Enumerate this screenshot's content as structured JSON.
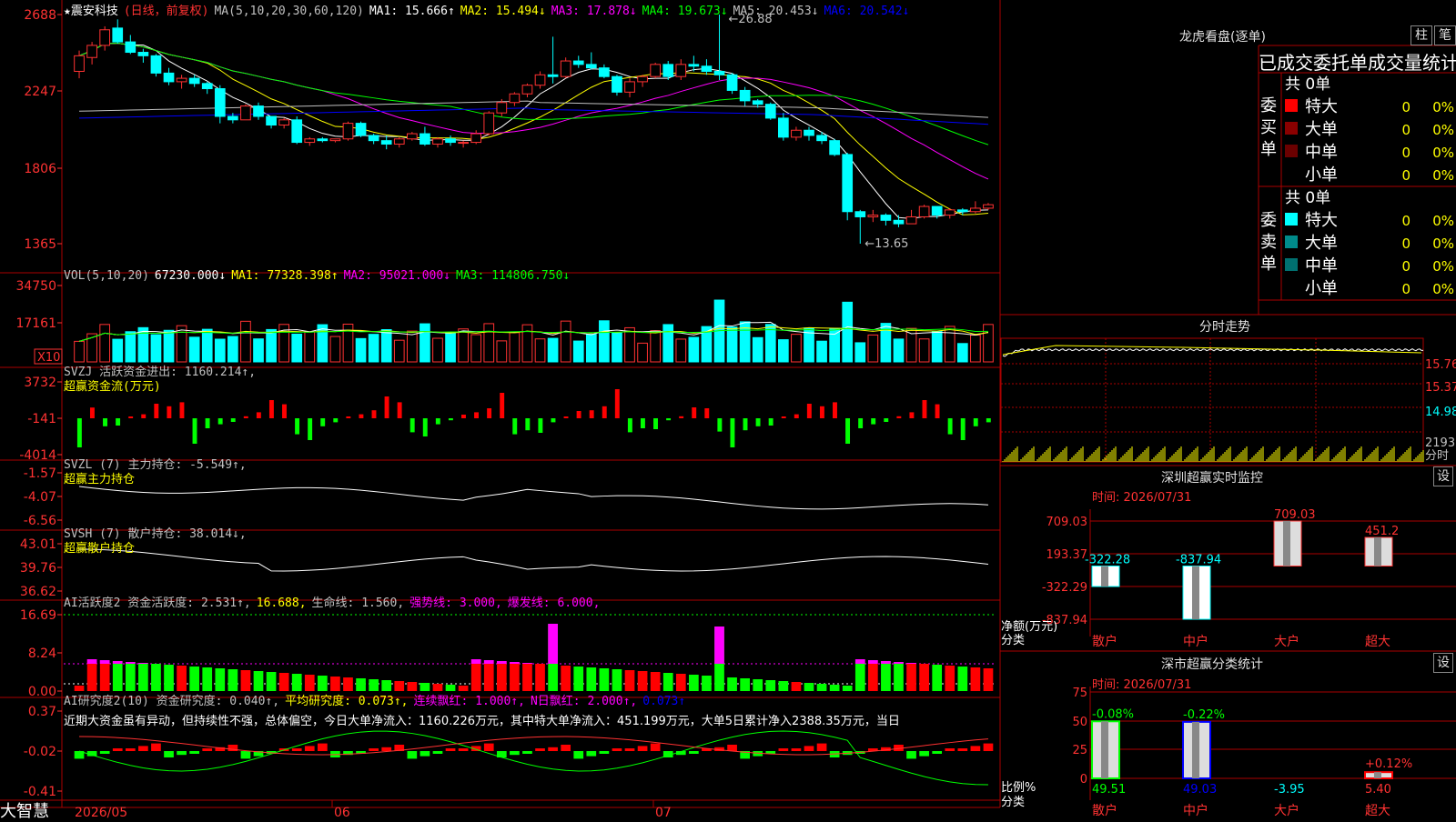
{
  "stock": {
    "title": "★震安科技",
    "mode": "(日线，前复权)"
  },
  "ma_header": [
    {
      "label": "MA(5,10,20,30,60,120)",
      "color": "#c0c0c0"
    },
    {
      "label": "MA1: 15.666↑",
      "color": "#ffffff"
    },
    {
      "label": "MA2: 15.494↓",
      "color": "#ffff00"
    },
    {
      "label": "MA3: 17.878↓",
      "color": "#ff00ff"
    },
    {
      "label": "MA4: 19.673↓",
      "color": "#00ff00"
    },
    {
      "label": "MA5: 20.453↓",
      "color": "#c0c0c0"
    },
    {
      "label": "MA6: 20.542↓",
      "color": "#0000ff"
    }
  ],
  "vol_header": [
    {
      "label": "VOL(5,10,20)",
      "color": "#c0c0c0"
    },
    {
      "label": "67230.000↓",
      "color": "#ffffff"
    },
    {
      "label": "MA1: 77328.398↑",
      "color": "#ffff00"
    },
    {
      "label": "MA2: 95021.000↓",
      "color": "#ff00ff"
    },
    {
      "label": "MA3: 114806.750↓",
      "color": "#00ff00"
    }
  ],
  "svzj_header": [
    {
      "label": "SVZJ  活跃资金进出: 1160.214↑,",
      "color": "#c0c0c0"
    }
  ],
  "svzj_sub": "超赢资金流(万元)",
  "svzl_header": [
    {
      "label": "SVZL (7) 主力持仓: -5.549↑,",
      "color": "#c0c0c0"
    }
  ],
  "svzl_sub": "超赢主力持仓",
  "svsh_header": [
    {
      "label": "SVSH (7) 散户持仓: 38.014↓,",
      "color": "#c0c0c0"
    }
  ],
  "svsh_sub": "超赢散户持仓",
  "ai1_header": [
    {
      "label": "AI活跃度2 资金活跃度: 2.531↑,",
      "color": "#c0c0c0"
    },
    {
      "label": "16.688,",
      "color": "#ffff00"
    },
    {
      "label": "生命线: 1.560,",
      "color": "#c0c0c0"
    },
    {
      "label": "强势线: 3.000,",
      "color": "#ff00ff"
    },
    {
      "label": "爆发线: 6.000,",
      "color": "#ff00ff"
    }
  ],
  "ai2_header": [
    {
      "label": "AI研究度2(10) 资金研究度: 0.040↑,",
      "color": "#c0c0c0"
    },
    {
      "label": "平均研究度: 0.073↑,",
      "color": "#ffff00"
    },
    {
      "label": "连续飘红: 1.000↑,",
      "color": "#ff00ff"
    },
    {
      "label": "N日飘红: 2.000↑,",
      "color": "#ff00ff"
    },
    {
      "label": "0.073↑",
      "color": "#0000ff"
    }
  ],
  "ai2_text": "近期大资金虽有异动，但持续性不强，总体偏空，今日大单净流入：1160.226万元，其中特大单净流入：451.199万元，大单5日累计净入2388.35万元，当日",
  "price_ticks": [
    "2688",
    "2247",
    "1806",
    "1365"
  ],
  "vol_ticks": [
    "34750",
    "17161"
  ],
  "vol_unit": "X10",
  "svzj_ticks": [
    "3732",
    "-141",
    "-4014"
  ],
  "svzl_ticks": [
    "-1.57",
    "-4.07",
    "-6.56"
  ],
  "svsh_ticks": [
    "43.01",
    "39.76",
    "36.62"
  ],
  "ai1_ticks": [
    "16.69",
    "8.24",
    "0.00"
  ],
  "ai2_ticks": [
    "0.37",
    "-0.02",
    "-0.41"
  ],
  "price_annot": {
    "high": "←26.88",
    "low": "←13.65"
  },
  "date_labels": [
    "2026/05",
    "06",
    "07"
  ],
  "brand": "大智慧",
  "dragon": {
    "title": "龙虎看盘(逐单)",
    "btn1": "柱",
    "btn2": "笔",
    "stat_title": "已成交委托单成交量统计",
    "buy_label": "委买单",
    "sell_label": "委卖单",
    "buy_count": "共 0单",
    "sell_count": "共 0单",
    "buy_rows": [
      {
        "name": "特大",
        "v": "0",
        "p": "0%",
        "c": "#ff0000"
      },
      {
        "name": "大单",
        "v": "0",
        "p": "0%",
        "c": "#8b0000"
      },
      {
        "name": "中单",
        "v": "0",
        "p": "0%",
        "c": "#6b0000"
      },
      {
        "name": "小单",
        "v": "0",
        "p": "0%",
        "c": ""
      }
    ],
    "sell_rows": [
      {
        "name": "特大",
        "v": "0",
        "p": "0%",
        "c": "#00ffff"
      },
      {
        "name": "大单",
        "v": "0",
        "p": "0%",
        "c": "#008b8b"
      },
      {
        "name": "中单",
        "v": "0",
        "p": "0%",
        "c": "#007070"
      },
      {
        "name": "小单",
        "v": "0",
        "p": "0%",
        "c": ""
      }
    ]
  },
  "intraday": {
    "title": "分时走势",
    "ticks": [
      "15.76",
      "15.37",
      "14.98",
      "2193"
    ],
    "vol_label": "分时"
  },
  "sz_monitor": {
    "title": "深圳超赢实时监控",
    "btn": "设",
    "time": "时间: 2026/07/31",
    "ticks": [
      "709.03",
      "193.37",
      "-322.29",
      "-837.94"
    ],
    "ylabel": "净额(万元)",
    "xlabel": "分类",
    "cats": [
      "散户",
      "中户",
      "大户",
      "超大"
    ]
  },
  "sz_class": {
    "title": "深市超赢分类统计",
    "btn": "设",
    "time": "时间: 2026/07/31",
    "ticks": [
      "75",
      "50",
      "25",
      "0"
    ],
    "ylabel": "比例%",
    "xlabel": "分类",
    "cats": [
      "散户",
      "中户",
      "大户",
      "超大"
    ]
  },
  "chart_data": [
    {
      "type": "bar",
      "name": "深圳超赢实时监控",
      "categories": [
        "散户",
        "中户",
        "大户",
        "超大"
      ],
      "values": [
        -322.28,
        -837.94,
        709.03,
        451.2
      ],
      "ylim": [
        -837.94,
        709.03
      ]
    },
    {
      "type": "bar",
      "name": "深市超赢分类统计",
      "categories": [
        "散户",
        "中户",
        "大户",
        "超大"
      ],
      "series": [
        {
          "values": [
            49.51,
            49.03,
            -3.95,
            5.4
          ]
        },
        {
          "values": [
            -0.08,
            -0.22,
            0,
            0.12
          ]
        }
      ],
      "ylim": [
        0,
        75
      ]
    },
    {
      "type": "line",
      "name": "candles",
      "ylim": [
        13.65,
        26.88
      ],
      "ohlc": [
        [
          23.6,
          24.8,
          23.2,
          24.5
        ],
        [
          24.4,
          25.3,
          24.0,
          25.1
        ],
        [
          25.1,
          26.2,
          24.8,
          26.0
        ],
        [
          26.1,
          26.6,
          25.2,
          25.3
        ],
        [
          25.3,
          25.7,
          24.6,
          24.7
        ],
        [
          24.7,
          24.9,
          24.1,
          24.5
        ],
        [
          24.5,
          24.6,
          23.3,
          23.5
        ],
        [
          23.5,
          23.8,
          22.8,
          23.0
        ],
        [
          23.0,
          23.4,
          22.6,
          23.2
        ],
        [
          23.2,
          23.4,
          22.7,
          22.9
        ],
        [
          22.9,
          23.0,
          22.3,
          22.6
        ],
        [
          22.6,
          22.8,
          20.6,
          21.0
        ],
        [
          21.0,
          21.2,
          20.6,
          20.8
        ],
        [
          20.8,
          21.7,
          20.8,
          21.6
        ],
        [
          21.6,
          21.8,
          20.8,
          21.0
        ],
        [
          21.0,
          21.0,
          20.3,
          20.5
        ],
        [
          20.5,
          20.9,
          20.3,
          20.8
        ],
        [
          20.8,
          21.0,
          19.4,
          19.5
        ],
        [
          19.5,
          19.8,
          19.3,
          19.7
        ],
        [
          19.7,
          19.8,
          19.5,
          19.6
        ],
        [
          19.6,
          19.7,
          19.5,
          19.7
        ],
        [
          19.7,
          20.7,
          19.6,
          20.6
        ],
        [
          20.6,
          20.7,
          19.8,
          19.9
        ],
        [
          19.9,
          20.0,
          19.4,
          19.6
        ],
        [
          19.6,
          19.9,
          19.1,
          19.4
        ],
        [
          19.4,
          19.8,
          19.2,
          19.7
        ],
        [
          19.7,
          20.1,
          19.6,
          20.0
        ],
        [
          20.0,
          20.4,
          19.3,
          19.4
        ],
        [
          19.4,
          19.8,
          19.2,
          19.7
        ],
        [
          19.7,
          19.9,
          19.3,
          19.5
        ],
        [
          19.5,
          19.6,
          19.2,
          19.5
        ],
        [
          19.5,
          20.2,
          19.4,
          20.0
        ],
        [
          20.0,
          21.3,
          19.9,
          21.2
        ],
        [
          21.2,
          22.0,
          21.0,
          21.8
        ],
        [
          21.8,
          22.4,
          21.6,
          22.3
        ],
        [
          22.3,
          22.9,
          22.1,
          22.8
        ],
        [
          22.8,
          23.6,
          22.6,
          23.4
        ],
        [
          23.4,
          25.6,
          22.9,
          23.3
        ],
        [
          23.3,
          24.4,
          23.2,
          24.2
        ],
        [
          24.2,
          24.5,
          23.8,
          24.0
        ],
        [
          24.0,
          24.7,
          23.7,
          23.8
        ],
        [
          23.8,
          24.0,
          23.2,
          23.3
        ],
        [
          23.3,
          23.4,
          22.2,
          22.4
        ],
        [
          22.4,
          23.2,
          22.1,
          23.0
        ],
        [
          23.0,
          23.4,
          22.7,
          23.3
        ],
        [
          23.3,
          24.1,
          23.2,
          24.0
        ],
        [
          24.0,
          24.2,
          23.1,
          23.3
        ],
        [
          23.3,
          24.3,
          23.1,
          24.0
        ],
        [
          24.0,
          24.5,
          23.6,
          23.9
        ],
        [
          23.9,
          24.3,
          23.4,
          23.6
        ],
        [
          23.6,
          26.88,
          23.1,
          23.4
        ],
        [
          23.4,
          23.5,
          22.3,
          22.5
        ],
        [
          22.5,
          22.7,
          21.6,
          21.9
        ],
        [
          21.9,
          22.0,
          21.5,
          21.7
        ],
        [
          21.7,
          21.8,
          20.8,
          20.9
        ],
        [
          20.9,
          21.2,
          19.6,
          19.8
        ],
        [
          19.8,
          20.4,
          19.6,
          20.2
        ],
        [
          20.2,
          20.4,
          19.6,
          19.9
        ],
        [
          19.9,
          20.1,
          19.4,
          19.6
        ],
        [
          19.6,
          19.7,
          18.7,
          18.8
        ],
        [
          18.8,
          18.9,
          15.0,
          15.5
        ],
        [
          15.5,
          15.6,
          13.65,
          15.2
        ],
        [
          15.2,
          15.6,
          14.9,
          15.3
        ],
        [
          15.3,
          15.4,
          14.7,
          15.0
        ],
        [
          15.0,
          15.3,
          14.6,
          14.8
        ],
        [
          14.8,
          15.6,
          14.8,
          15.2
        ],
        [
          15.2,
          15.9,
          15.1,
          15.8
        ],
        [
          15.8,
          15.8,
          15.1,
          15.3
        ],
        [
          15.3,
          15.7,
          15.1,
          15.6
        ],
        [
          15.6,
          15.7,
          15.3,
          15.5
        ],
        [
          15.5,
          16.1,
          15.4,
          15.7
        ],
        [
          15.7,
          16.0,
          15.6,
          15.9
        ]
      ]
    }
  ]
}
